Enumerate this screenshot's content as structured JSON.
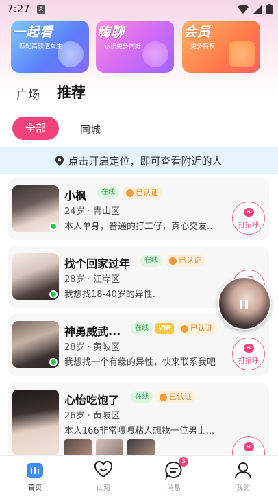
{
  "status_bar": {
    "time": "7:27",
    "notif_letter": "A"
  },
  "promos": [
    {
      "title": "一起看",
      "subtitle": "匹配高颜值女生"
    },
    {
      "title": "嗨聊",
      "subtitle": "认识更多同好"
    },
    {
      "title": "会员",
      "subtitle": "更多特权"
    }
  ],
  "tabs": {
    "plaza": "广场",
    "recommend": "推荐"
  },
  "filters": {
    "all": "全部",
    "same_city": "同城"
  },
  "location": {
    "text": "点击开启定位，即可查看附近的人"
  },
  "labels": {
    "online": "在线",
    "verified": "已认证",
    "vip": "VIP",
    "greet": "打招呼",
    "hi": "Hi"
  },
  "users": [
    {
      "name": "小枫",
      "meta": "24岁 · 青山区",
      "bio": "本人单身，普通的打工仔，真心交友...",
      "vip": false
    },
    {
      "name": "找个回家过年",
      "meta": "28岁 · 江岸区",
      "bio": "我想找18-40岁的异性.",
      "vip": false
    },
    {
      "name": "神勇威武...",
      "meta": "28岁 · 黄陂区",
      "bio": "我想找一个有缘的异性，快来联系我吧",
      "vip": true
    },
    {
      "name": "心怡吃饱了",
      "meta": "26岁 · 黄陂区",
      "bio": "本人166非常嘎嘎粘人想找一位男士...",
      "vip": false
    }
  ],
  "nav": {
    "home": "首页",
    "moment": "此刻",
    "messages": "消息",
    "messages_badge": "3",
    "mine": "我的"
  },
  "colors": {
    "accent": "#f5427a",
    "online_green": "#2bc45a",
    "verified_orange": "#e28b2d"
  }
}
